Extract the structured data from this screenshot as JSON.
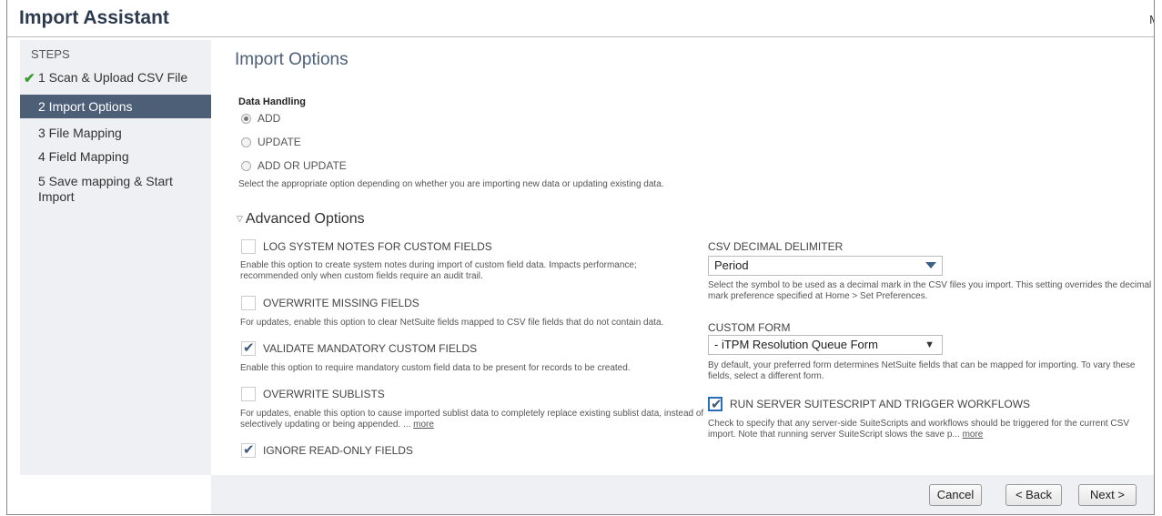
{
  "header": {
    "title": "Import Assistant",
    "right_text": "M"
  },
  "sidebar": {
    "title": "STEPS",
    "steps": [
      {
        "label": "1 Scan & Upload CSV File",
        "state": "done"
      },
      {
        "label": "2 Import Options",
        "state": "active"
      },
      {
        "label": "3 File Mapping",
        "state": "pending"
      },
      {
        "label": "4 Field Mapping",
        "state": "pending"
      },
      {
        "label": "5 Save mapping & Start Import",
        "state": "pending"
      }
    ]
  },
  "main": {
    "title": "Import Options",
    "data_handling": {
      "label": "Data Handling",
      "options": [
        {
          "label": "ADD",
          "selected": true
        },
        {
          "label": "UPDATE",
          "selected": false
        },
        {
          "label": "ADD OR UPDATE",
          "selected": false
        }
      ],
      "help": "Select the appropriate option depending on whether you are importing new data or updating existing data."
    },
    "advanced": {
      "title": "Advanced Options",
      "left": [
        {
          "label": "LOG SYSTEM NOTES FOR CUSTOM FIELDS",
          "checked": false,
          "help": "Enable this option to create system notes during import of custom field data. Impacts performance; recommended only when custom fields require an audit trail."
        },
        {
          "label": "OVERWRITE MISSING FIELDS",
          "checked": false,
          "help": "For updates, enable this option to clear NetSuite fields mapped to CSV file fields that do not contain data."
        },
        {
          "label": "VALIDATE MANDATORY CUSTOM FIELDS",
          "checked": true,
          "help": "Enable this option to require mandatory custom field data to be present for records to be created."
        },
        {
          "label": "OVERWRITE SUBLISTS",
          "checked": false,
          "help": "For updates, enable this option to cause imported sublist data to completely replace existing sublist data, instead of selectively updating or being appended. ...",
          "more": "more"
        },
        {
          "label": "IGNORE READ-ONLY FIELDS",
          "checked": true,
          "help": ""
        }
      ],
      "csv_decimal": {
        "label": "CSV DECIMAL DELIMITER",
        "value": "Period",
        "help": "Select the symbol to be used as a decimal mark in the CSV files you import. This setting overrides the decimal mark preference specified at Home > Set Preferences."
      },
      "custom_form": {
        "label": "CUSTOM FORM",
        "value": "- iTPM Resolution Queue Form",
        "help": "By default, your preferred form determines NetSuite fields that can be mapped for importing. To vary these fields, select a different form."
      },
      "run_server": {
        "label": "RUN SERVER SUITESCRIPT AND TRIGGER WORKFLOWS",
        "checked": true,
        "help": "Check to specify that any server-side SuiteScripts and workflows should be triggered for the current CSV import. Note that running server SuiteScript slows the save p...",
        "more": "more"
      }
    }
  },
  "footer": {
    "cancel": "Cancel",
    "back": "< Back",
    "next": "Next >"
  },
  "colors": {
    "accent": "#4d5e77",
    "check_green": "#3a9a2f",
    "panel": "#eef0f3"
  },
  "icons": {
    "done": "checkmark-icon",
    "checkbox": "checkmark-icon",
    "dropdown": "chevron-down-icon",
    "collapse": "triangle-down-icon"
  }
}
